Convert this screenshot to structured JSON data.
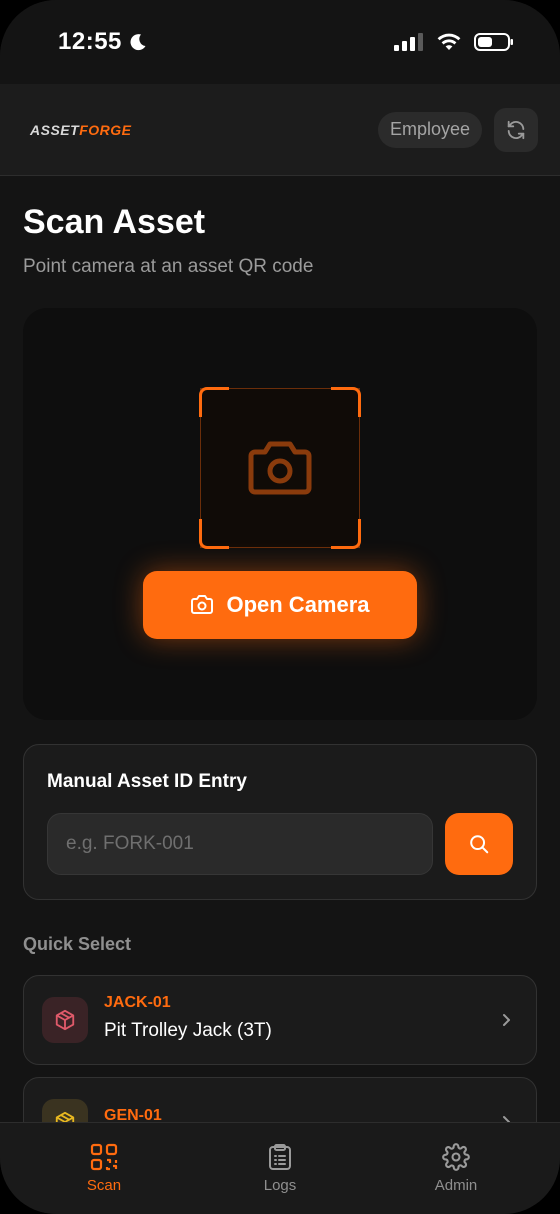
{
  "status_bar": {
    "time": "12:55"
  },
  "header": {
    "logo_part1": "ASSET",
    "logo_part2": "FORGE",
    "role": "Employee"
  },
  "main": {
    "title": "Scan Asset",
    "subtitle": "Point camera at an asset QR code",
    "open_camera_label": "Open Camera"
  },
  "manual_entry": {
    "title": "Manual Asset ID Entry",
    "placeholder": "e.g. FORK-001",
    "value": ""
  },
  "quick_select": {
    "label": "Quick Select",
    "items": [
      {
        "id": "JACK-01",
        "name": "Pit Trolley Jack (3T)",
        "icon": "box-icon",
        "icon_color": "#e05a6a",
        "icon_bg": "#3a2326"
      },
      {
        "id": "GEN-01",
        "name": "",
        "icon": "box-icon",
        "icon_color": "#e8b820",
        "icon_bg": "#3a3320"
      }
    ]
  },
  "bottom_nav": {
    "items": [
      {
        "label": "Scan",
        "icon": "qr-code-icon",
        "active": true
      },
      {
        "label": "Logs",
        "icon": "clipboard-icon",
        "active": false
      },
      {
        "label": "Admin",
        "icon": "gear-icon",
        "active": false
      }
    ]
  },
  "colors": {
    "accent": "#ff6b0f",
    "background": "#141414",
    "card": "#1b1b1b"
  }
}
